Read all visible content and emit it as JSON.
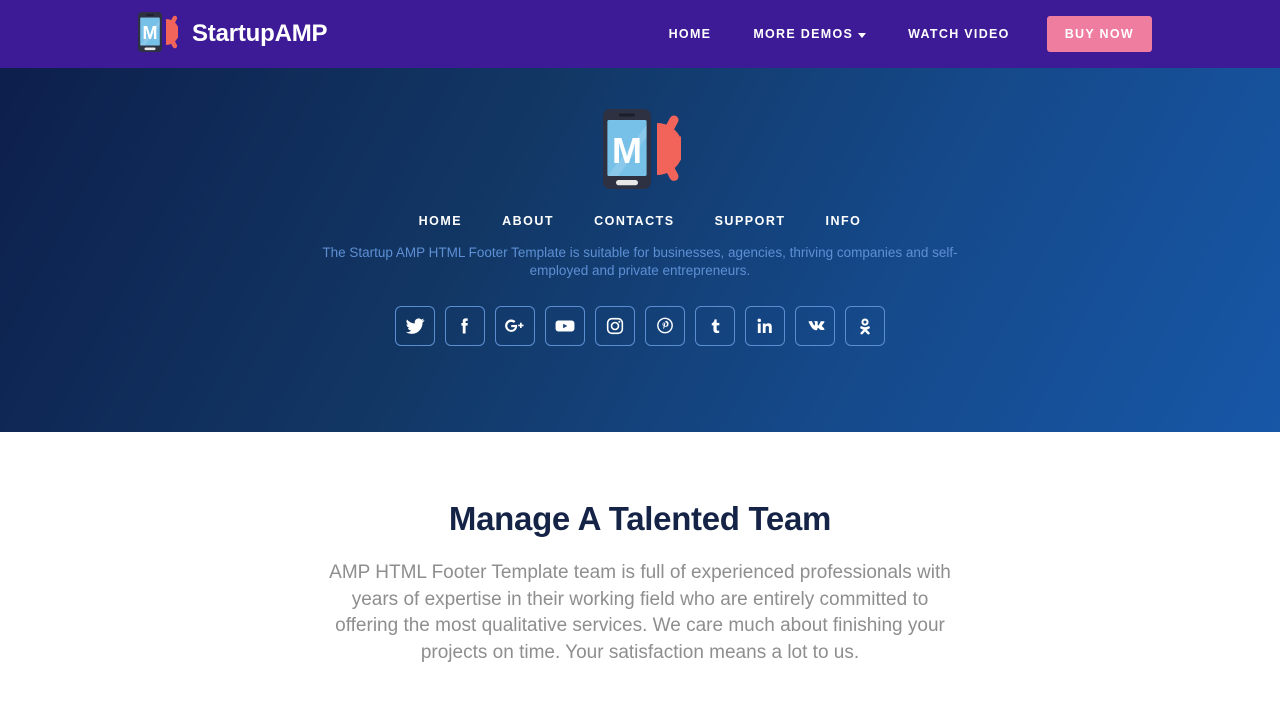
{
  "header": {
    "brand": {
      "logo_icon": "startup-amp-phone-megaphone-logo",
      "name": "StartupAMP"
    },
    "nav": [
      {
        "label": "HOME",
        "has_caret": false
      },
      {
        "label": "MORE DEMOS",
        "has_caret": true
      },
      {
        "label": "WATCH VIDEO",
        "has_caret": false
      }
    ],
    "cta": {
      "label": "BUY NOW"
    },
    "colors": {
      "background": "#3d1a96",
      "cta_background": "#ef7da0",
      "text": "#ffffff"
    }
  },
  "hero": {
    "logo_icon": "startup-amp-phone-megaphone-logo",
    "nav": [
      {
        "label": "HOME"
      },
      {
        "label": "ABOUT"
      },
      {
        "label": "CONTACTS"
      },
      {
        "label": "SUPPORT"
      },
      {
        "label": "INFO"
      }
    ],
    "description": "The Startup AMP HTML Footer Template is suitable for businesses, agencies, thriving companies and self-employed and private entrepreneurs.",
    "social": [
      {
        "name": "twitter",
        "icon": "twitter-icon"
      },
      {
        "name": "facebook",
        "icon": "facebook-icon"
      },
      {
        "name": "google-plus",
        "icon": "google-plus-icon"
      },
      {
        "name": "youtube",
        "icon": "youtube-icon"
      },
      {
        "name": "instagram",
        "icon": "instagram-icon"
      },
      {
        "name": "pinterest",
        "icon": "pinterest-icon"
      },
      {
        "name": "tumblr",
        "icon": "tumblr-icon"
      },
      {
        "name": "linkedin",
        "icon": "linkedin-icon"
      },
      {
        "name": "vk",
        "icon": "vk-icon"
      },
      {
        "name": "odnoklassniki",
        "icon": "odnoklassniki-icon"
      }
    ],
    "colors": {
      "gradient_start": "#0d1f4c",
      "gradient_end": "#1757a7",
      "description_text": "#5d8fd4",
      "social_border": "#5b8ed0"
    }
  },
  "content": {
    "title": "Manage A Talented Team",
    "paragraph": "AMP HTML Footer Template team is full of experienced professionals with years of expertise in their working field who are entirely committed to offering the most qualitative services. We care much about finishing your projects on time. Your satisfaction means a lot to us.",
    "colors": {
      "title": "#152347",
      "paragraph": "#8e8e8e",
      "background": "#ffffff"
    }
  }
}
